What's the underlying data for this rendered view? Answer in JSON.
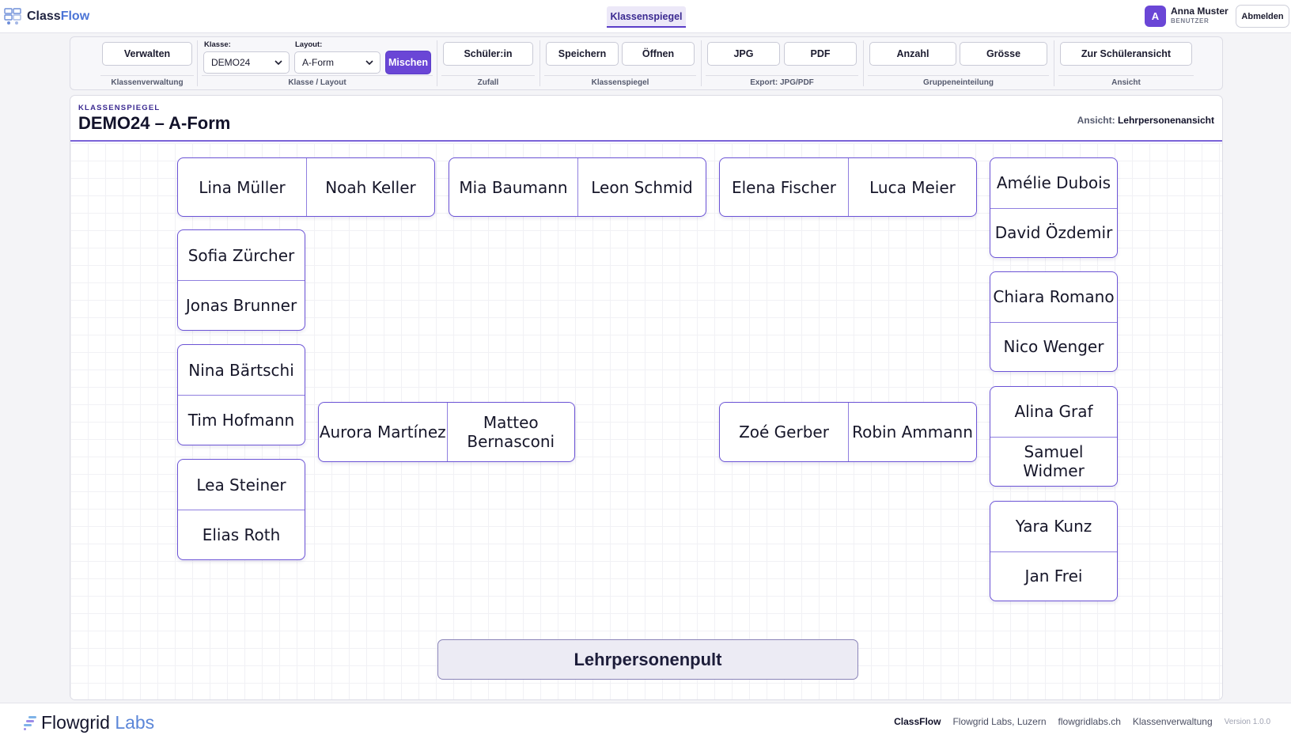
{
  "app": {
    "brand_prefix": "Class",
    "brand_suffix": "Flow",
    "active_tab": "Klassenspiegel"
  },
  "user": {
    "initial": "A",
    "name": "Anna Muster",
    "role": "BENUTZER",
    "logout_label": "Abmelden"
  },
  "toolbar": {
    "verwalten": "Verwalten",
    "klassenverwaltung": "Klassenverwaltung",
    "klasse_label": "Klasse:",
    "klasse_value": "DEMO24",
    "layout_label": "Layout:",
    "layout_value": "A-Form",
    "mischen": "Mischen",
    "klasse_layout": "Klasse / Layout",
    "schueler": "Schüler:in",
    "zufall": "Zufall",
    "speichern": "Speichern",
    "oeffnen": "Öffnen",
    "klassenspiegel": "Klassenspiegel",
    "jpg": "JPG",
    "pdf": "PDF",
    "export": "Export: JPG/PDF",
    "anzahl": "Anzahl",
    "groesse": "Grösse",
    "gruppeneinteilung": "Gruppeneinteilung",
    "schueleransicht": "Zur Schüleransicht",
    "ansicht": "Ansicht"
  },
  "panel": {
    "kicker": "KLASSENSPIEGEL",
    "title": "DEMO24 – A-Form",
    "view_label": "Ansicht:",
    "view_value": "Lehrpersonenansicht"
  },
  "desks": [
    [
      "Lina Müller",
      "Noah Keller"
    ],
    [
      "Mia Baumann",
      "Leon Schmid"
    ],
    [
      "Elena Fischer",
      "Luca Meier"
    ],
    [
      "Amélie Dubois",
      "David Özdemir"
    ],
    [
      "Sofia Zürcher",
      "Jonas Brunner"
    ],
    [
      "Chiara Romano",
      "Nico Wenger"
    ],
    [
      "Nina Bärtschi",
      "Tim Hofmann"
    ],
    [
      "Aurora Martínez",
      "Matteo Bernasconi"
    ],
    [
      "Zoé Gerber",
      "Robin Ammann"
    ],
    [
      "Alina Graf",
      "Samuel Widmer"
    ],
    [
      "Lea Steiner",
      "Elias Roth"
    ],
    [
      "Yara Kunz",
      "Jan Frei"
    ]
  ],
  "teacher_desk": "Lehrpersonenpult",
  "footer": {
    "logo_prefix": "Flowgrid",
    "logo_suffix": "Labs",
    "links": [
      "ClassFlow",
      "Flowgrid Labs, Luzern",
      "flowgridlabs.ch",
      "Klassenverwaltung"
    ],
    "version": "Version 1.0.0"
  },
  "colors": {
    "accent": "#6a46d6",
    "desk_border": "#6c54d6",
    "brand_blue": "#4b74d6"
  }
}
